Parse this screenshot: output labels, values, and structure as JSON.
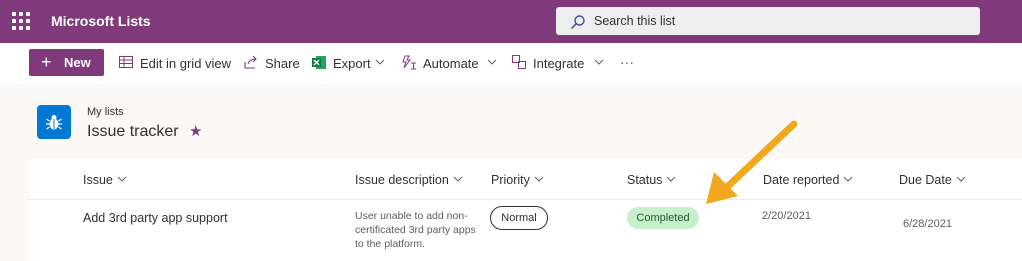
{
  "suitebar": {
    "app_title": "Microsoft Lists",
    "search_placeholder": "Search this list"
  },
  "commandbar": {
    "new_label": "New",
    "edit_grid_label": "Edit in grid view",
    "share_label": "Share",
    "export_label": "Export",
    "automate_label": "Automate",
    "integrate_label": "Integrate",
    "more_label": "···"
  },
  "header": {
    "breadcrumb": "My lists",
    "title": "Issue tracker",
    "favorite_icon": "★"
  },
  "table": {
    "columns": [
      "Issue",
      "Issue description",
      "Priority",
      "Status",
      "Date reported",
      "Due Date"
    ],
    "rows": [
      {
        "issue": "Add 3rd party app support",
        "description": "User unable to add non-certificated 3rd party apps to the platform.",
        "priority": "Normal",
        "status": "Completed",
        "date_reported": "2/20/2021",
        "due_date": "6/28/2021"
      }
    ]
  },
  "colors": {
    "brand": "#80397b",
    "status_completed_bg": "#c8efcb",
    "annotation_arrow": "#f2a81d"
  }
}
